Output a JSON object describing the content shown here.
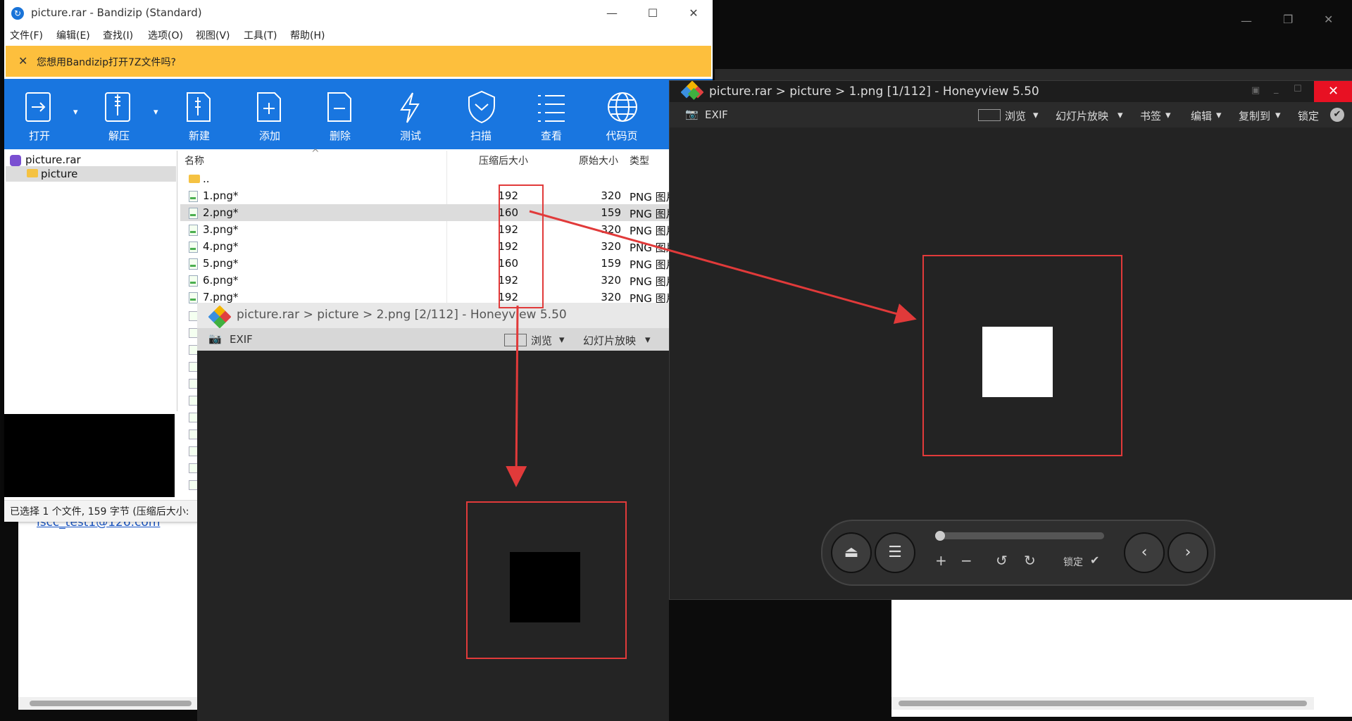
{
  "bandizip": {
    "title": "picture.rar - Bandizip (Standard)",
    "menu": [
      "文件(F)",
      "编辑(E)",
      "查找(I)",
      "选项(O)",
      "视图(V)",
      "工具(T)",
      "帮助(H)"
    ],
    "notice": "您想用Bandizip打开7Z文件吗?",
    "toolbar": [
      "打开",
      "解压",
      "新建",
      "添加",
      "删除",
      "测试",
      "扫描",
      "查看",
      "代码页"
    ],
    "tree": {
      "root": "picture.rar",
      "child": "picture"
    },
    "columns": {
      "name": "名称",
      "compressed": "压缩后大小",
      "original": "原始大小",
      "type": "类型"
    },
    "parent_row": "..",
    "files": [
      {
        "name": "1.png*",
        "compressed": "192",
        "original": "320",
        "type": "PNG 图片"
      },
      {
        "name": "2.png*",
        "compressed": "160",
        "original": "159",
        "type": "PNG 图片"
      },
      {
        "name": "3.png*",
        "compressed": "192",
        "original": "320",
        "type": "PNG 图片"
      },
      {
        "name": "4.png*",
        "compressed": "192",
        "original": "320",
        "type": "PNG 图片"
      },
      {
        "name": "5.png*",
        "compressed": "160",
        "original": "159",
        "type": "PNG 图片"
      },
      {
        "name": "6.png*",
        "compressed": "192",
        "original": "320",
        "type": "PNG 图片"
      },
      {
        "name": "7.png*",
        "compressed": "192",
        "original": "320",
        "type": "PNG 图片"
      }
    ],
    "status": "已选择 1 个文件, 159 字节 (压缩后大小:"
  },
  "background": {
    "email": "iscc_test1@126.com"
  },
  "honeyview_small": {
    "title": "picture.rar > picture > 2.png [2/112] - Honeyview 5.50",
    "exif": "EXIF",
    "browse": "浏览",
    "slideshow": "幻灯片放映"
  },
  "honeyview_large": {
    "title": "picture.rar > picture > 1.png [1/112] - Honeyview 5.50",
    "exif": "EXIF",
    "menu": [
      "浏览",
      "幻灯片放映",
      "书签",
      "编辑",
      "复制到"
    ],
    "lock": "锁定",
    "controls_lock": "锁定"
  },
  "colors": {
    "toolbar_blue": "#1976e0",
    "notice_yellow": "#fdbf3d",
    "annotation_red": "#e13a3a"
  }
}
